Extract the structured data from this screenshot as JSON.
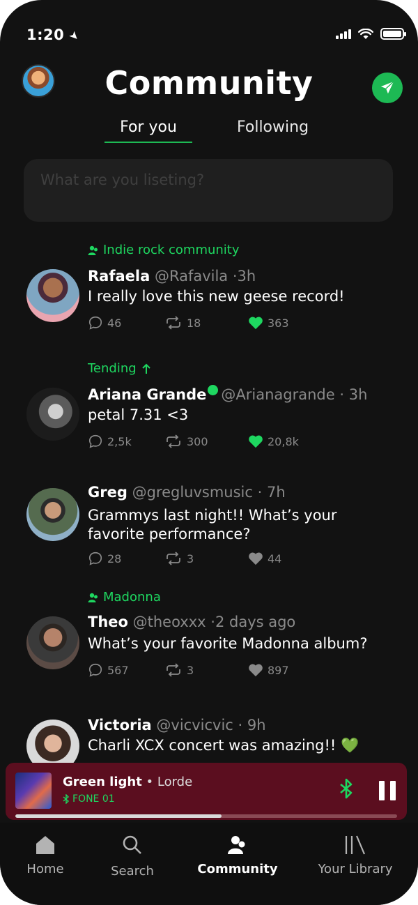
{
  "status": {
    "time": "1:20"
  },
  "header": {
    "title": "Community"
  },
  "tabs": [
    {
      "label": "For you",
      "active": true
    },
    {
      "label": "Following",
      "active": false
    }
  ],
  "composer": {
    "placeholder": "What are you liseting?"
  },
  "posts": [
    {
      "tag": "Indie rock community",
      "tag_icon": "community-icon",
      "name": "Rafaela",
      "handle": "@Rafavila",
      "time": "·3h",
      "verified": false,
      "text": "I really love this new geese record!",
      "comments": "46",
      "reposts": "18",
      "likes": "363",
      "liked": true
    },
    {
      "tag": "Tending",
      "tag_icon": "arrow-up-icon",
      "name": "Ariana Grande",
      "handle": "@Arianagrande",
      "time": "· 3h",
      "verified": true,
      "text": "petal 7.31 <3",
      "comments": "2,5k",
      "reposts": "300",
      "likes": "20,8k",
      "liked": true
    },
    {
      "tag": "",
      "name": "Greg",
      "handle": "@gregluvsmusic",
      "time": "· 7h",
      "verified": false,
      "text": "Grammys last night!! What’s your favorite performance?",
      "comments": "28",
      "reposts": "3",
      "likes": "44",
      "liked": false
    },
    {
      "tag": "Madonna",
      "tag_icon": "community-icon",
      "name": "Theo",
      "handle": "@theoxxx",
      "time": "·2 days ago",
      "verified": false,
      "text": "What’s your favorite Madonna album?",
      "comments": "567",
      "reposts": "3",
      "likes": "897",
      "liked": false
    },
    {
      "tag": "",
      "name": "Victoria",
      "handle": "@vicvicvic",
      "time": "· 9h",
      "verified": false,
      "text": "Charli XCX concert was amazing!! 💚",
      "comments": "",
      "reposts": "",
      "likes": "",
      "liked": false
    }
  ],
  "player": {
    "song": "Green light",
    "separator": " • ",
    "artist": "Lorde",
    "device": "FONE 01",
    "progress": 0.54
  },
  "nav": [
    {
      "label": "Home",
      "icon": "home-icon"
    },
    {
      "label": "Search",
      "icon": "search-icon"
    },
    {
      "label": "Community",
      "icon": "community-icon",
      "active": true
    },
    {
      "label": "Your Library",
      "icon": "library-icon"
    }
  ],
  "colors": {
    "accent": "#1db954",
    "background": "#121212",
    "player_bg": "#5b0e1f"
  }
}
